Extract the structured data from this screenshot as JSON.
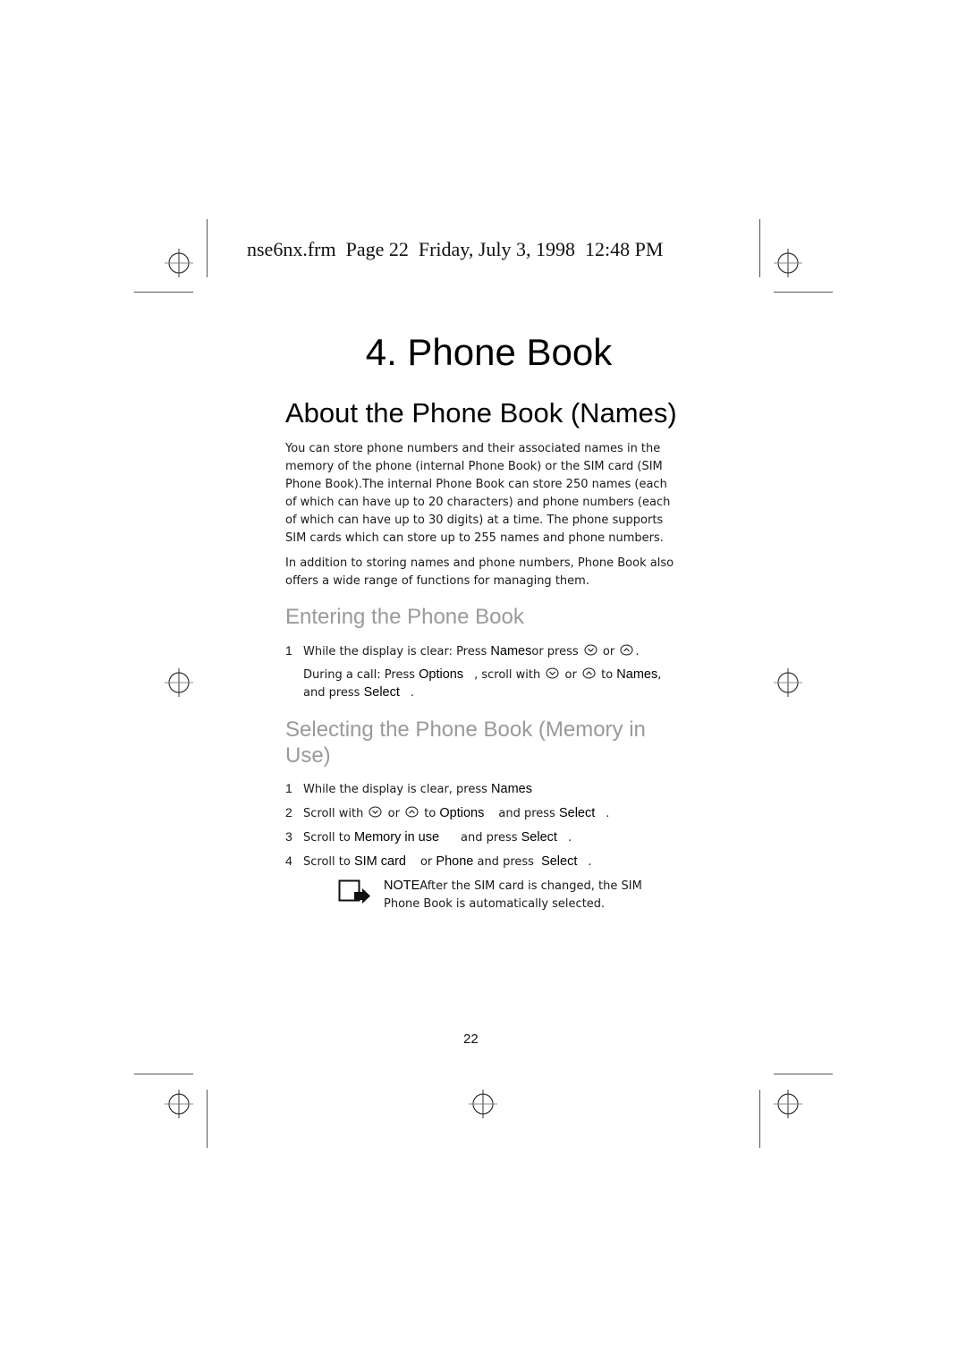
{
  "header": {
    "frame_info": "nse6nx.frm  Page 22  Friday, July 3, 1998  12:48 PM"
  },
  "chapter": {
    "title": "4. Phone Book"
  },
  "section_about": {
    "heading": "About the Phone Book (Names)",
    "paragraph_1": "You can store phone numbers and their associated names in the memory of the phone (internal Phone Book) or the SIM card (SIM Phone Book).The internal Phone Book can store 250 names (each of which can have up to 20 characters) and phone numbers (each of which can have up to 30 digits) at a time. The phone supports SIM cards which can store up to 255 names and phone numbers.",
    "paragraph_2": "In addition to storing names and phone numbers, Phone Book also offers a wide range of functions for managing them."
  },
  "section_entering": {
    "heading": "Entering the Phone Book",
    "step1": {
      "number": "1",
      "text_a": "While the display is clear: Press ",
      "key_names": "Names",
      "text_b": "or press ",
      "or": " or ",
      "end": "."
    },
    "step1_call": {
      "text_a": "During a call: Press ",
      "key_options": "Options",
      "text_b": ", scroll with ",
      "or": " or ",
      "text_c": " to ",
      "key_names": "Names",
      "text_d": ",",
      "text_e": "and press ",
      "key_select": "Select",
      "end": "."
    }
  },
  "section_selecting": {
    "heading": "Selecting the Phone Book (Memory in Use)",
    "steps": [
      {
        "number": "1",
        "text_a": "While the display is clear, press ",
        "key_a": "Names"
      },
      {
        "number": "2",
        "text_a": "Scroll with ",
        "or": " or ",
        "text_b": " to ",
        "key_a": "Options",
        "text_c": "and press ",
        "key_b": "Select",
        "end": "."
      },
      {
        "number": "3",
        "text_a": "Scroll to ",
        "key_a": "Memory in use",
        "text_c": "and press ",
        "key_b": "Select",
        "end": "."
      },
      {
        "number": "4",
        "text_a": "Scroll to ",
        "key_a": "SIM card",
        "text_b": "or ",
        "key_c": "Phone",
        "text_c": " and press ",
        "key_b": "Select",
        "end": "."
      }
    ],
    "note": {
      "label": "NOTE",
      "text": "After the SIM card is changed, the SIM Phone Book is automatically selected."
    }
  },
  "icons": {
    "scroll_down": "scroll-down-icon",
    "scroll_up": "scroll-up-icon",
    "note": "note-icon",
    "registration": "registration-target-icon"
  },
  "footer": {
    "page_number": "22"
  }
}
